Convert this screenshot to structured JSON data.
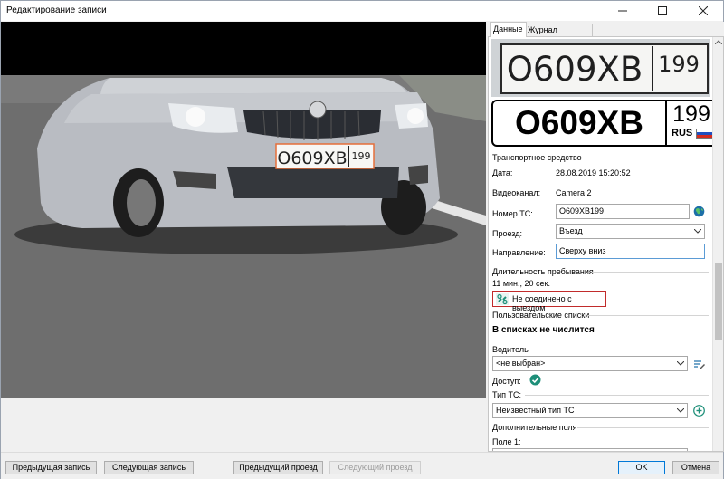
{
  "window": {
    "title": "Редактирование записи",
    "minimize_label": "—",
    "maximize_label": "☐",
    "close_label": "✕"
  },
  "video": {
    "plate_text": "О609ХВ",
    "plate_region": "199"
  },
  "tabs": [
    {
      "label": "Данные",
      "active": true
    },
    {
      "label": "Журнал редактирования",
      "active": false
    }
  ],
  "plate_crop": {
    "text": "О609ХВ",
    "region": "199"
  },
  "plate": {
    "main": "О609ХВ",
    "region": "199",
    "country": "RUS"
  },
  "vehicle": {
    "section_title": "Транспортное средство",
    "date_label": "Дата:",
    "date_value": "28.08.2019 15:20:52",
    "channel_label": "Видеоканал:",
    "channel_value": "Camera 2",
    "number_label": "Номер ТС:",
    "number_value": "О609ХВ199",
    "passage_label": "Проезд:",
    "passage_value": "Въезд",
    "direction_label": "Направление:",
    "direction_value": "Сверху вниз"
  },
  "stay": {
    "section_title": "Длительность пребывания",
    "duration": "11 мин., 20 сек.",
    "link_status": "Не соединено с выездом"
  },
  "lists": {
    "section_title": "Пользовательские списки",
    "status": "В списках не числится"
  },
  "driver": {
    "section_title": "Водитель",
    "value": "<не выбран>",
    "access_label": "Доступ:",
    "vehicle_type_label": "Тип ТС:",
    "vehicle_type_value": "Неизвестный тип ТС"
  },
  "extra": {
    "section_title": "Дополнительные поля",
    "field1_label": "Поле 1:"
  },
  "buttons": {
    "prev_record": "Предыдущая запись",
    "next_record": "Следующая запись",
    "prev_passage": "Предыдущий проезд",
    "next_passage": "Следующий проезд",
    "ok": "OK",
    "cancel": "Отмена"
  },
  "colors": {
    "accent": "#0078d7",
    "status_border": "#c12b2b",
    "access_ok": "#1e8f79",
    "plate_border": "#e56f3a"
  }
}
